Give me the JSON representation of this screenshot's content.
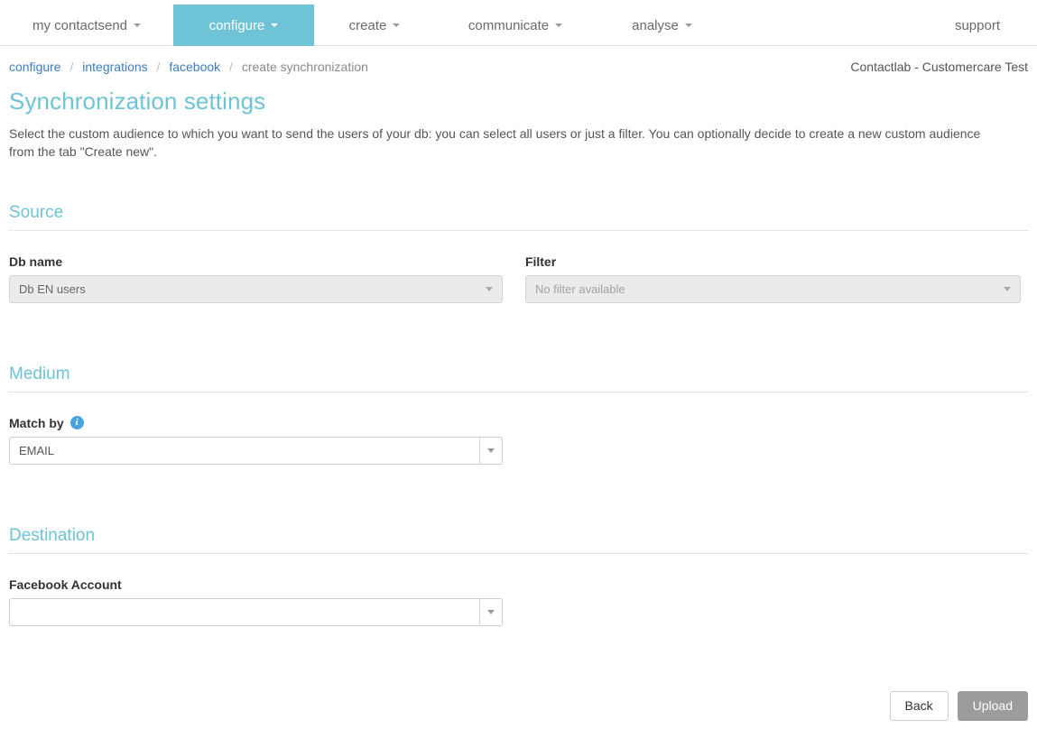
{
  "colors": {
    "brand_teal": "#6ec3d6",
    "link_blue": "#3b7ebf",
    "strip_blue": "#1075bd",
    "strip_green": "#7cc576",
    "strip_yellow": "#f7ba37",
    "strip_red": "#e8524a",
    "strip_purple": "#7b52ab",
    "info_icon_blue": "#4aa3df",
    "upload_gray": "#8b8b8b"
  },
  "navbar": {
    "items": [
      {
        "label": "my contactsend",
        "has_caret": true,
        "active": false
      },
      {
        "label": "configure",
        "has_caret": true,
        "active": true
      },
      {
        "label": "create",
        "has_caret": true,
        "active": false
      },
      {
        "label": "communicate",
        "has_caret": true,
        "active": false
      },
      {
        "label": "analyse",
        "has_caret": true,
        "active": false
      }
    ],
    "support_label": "support"
  },
  "breadcrumb": {
    "items": [
      {
        "label": "configure",
        "link": true
      },
      {
        "label": "integrations",
        "link": true
      },
      {
        "label": "facebook",
        "link": true
      },
      {
        "label": "create synchronization",
        "link": false
      }
    ],
    "separator": "/"
  },
  "header": {
    "account": "Contactlab - Customercare Test",
    "title": "Synchronization settings",
    "description": "Select the custom audience to which you want to send the users of your db: you can select all users or just a filter. You can optionally decide to create a new custom audience from the tab \"Create new\"."
  },
  "sections": {
    "source": {
      "title": "Source",
      "db_name": {
        "label": "Db name",
        "value": "Db EN users",
        "disabled": true
      },
      "filter": {
        "label": "Filter",
        "value": "No filter available",
        "disabled": true
      }
    },
    "medium": {
      "title": "Medium",
      "match_by": {
        "label": "Match by",
        "info_icon": "info-icon",
        "info_glyph": "i",
        "value": "EMAIL"
      }
    },
    "destination": {
      "title": "Destination",
      "facebook_account": {
        "label": "Facebook Account",
        "value": ""
      }
    }
  },
  "footer": {
    "back_label": "Back",
    "upload_label": "Upload"
  }
}
